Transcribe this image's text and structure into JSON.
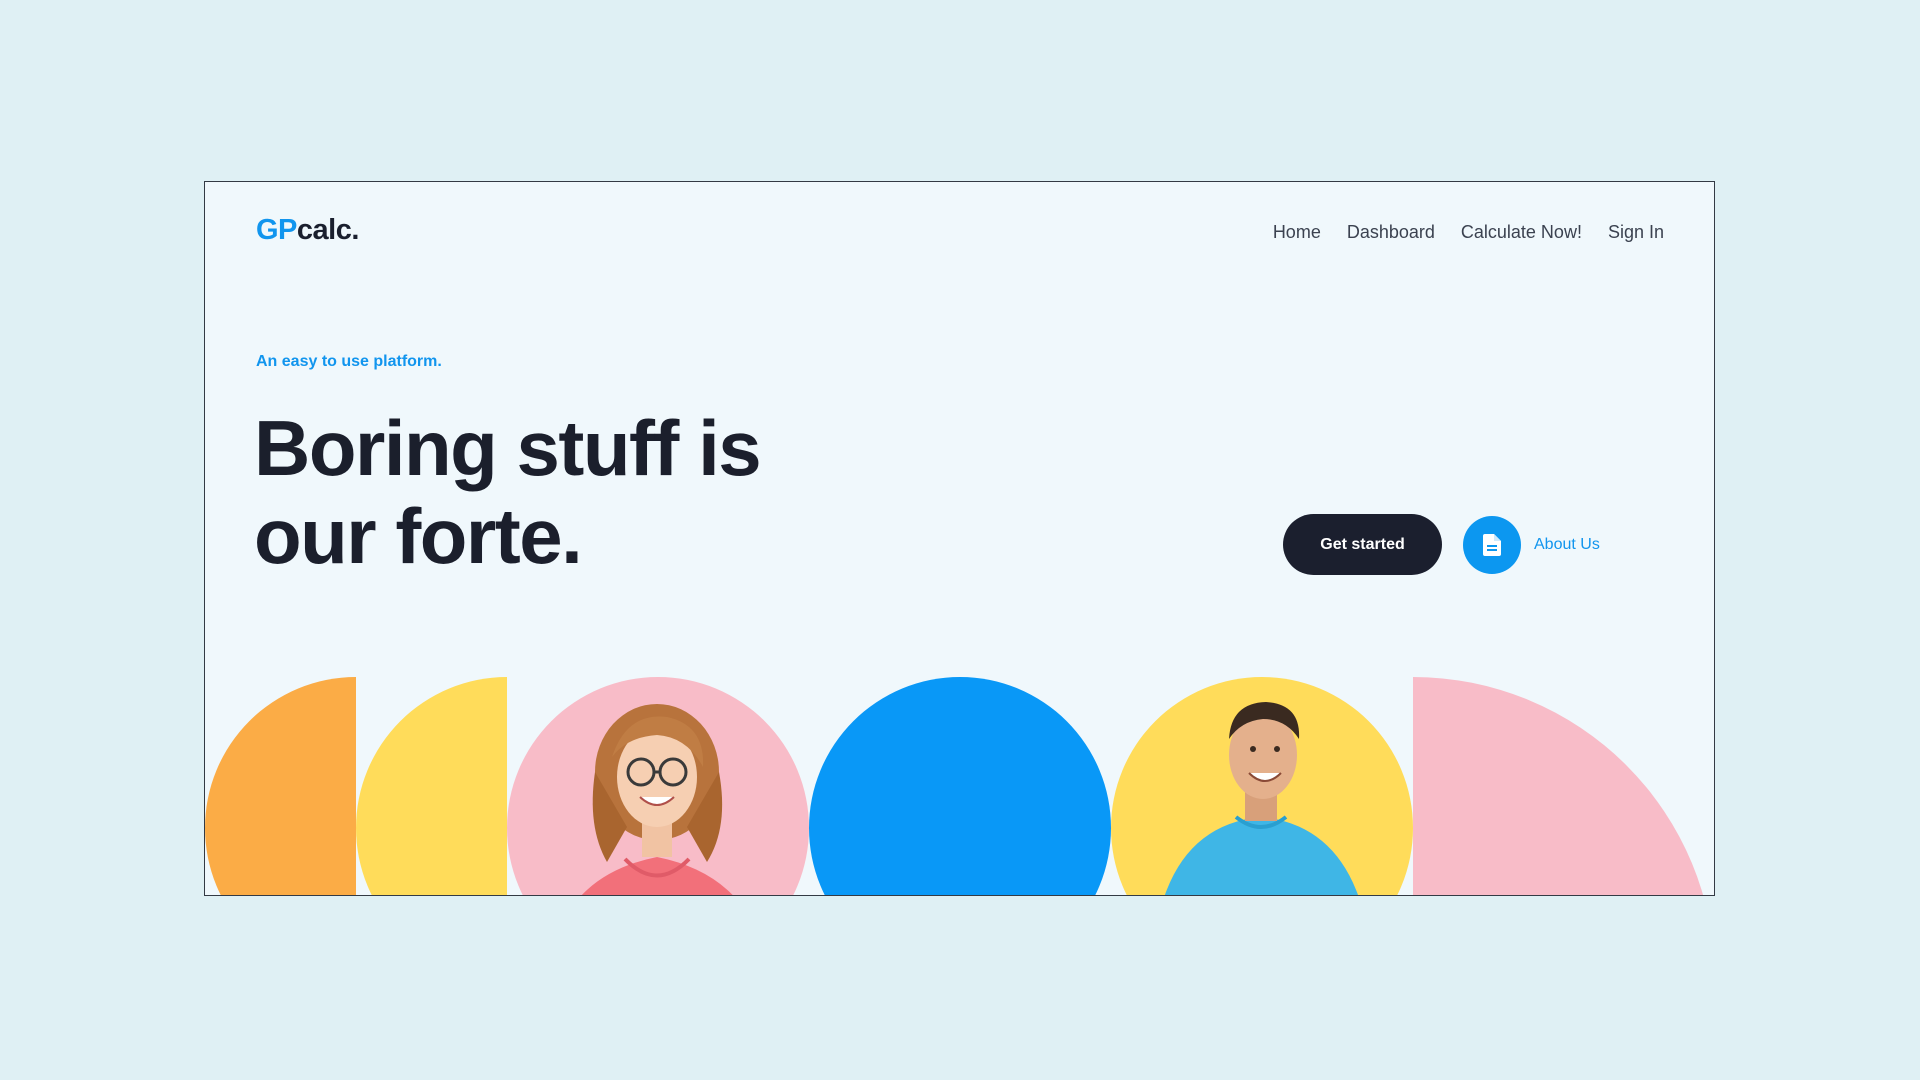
{
  "brand": {
    "logo_prefix": "GP",
    "logo_suffix": "calc.",
    "accent_color": "#1195ee",
    "dark_color": "#1b1f2e"
  },
  "nav": {
    "items": [
      {
        "label": "Home"
      },
      {
        "label": "Dashboard"
      },
      {
        "label": "Calculate Now!"
      },
      {
        "label": "Sign In"
      }
    ]
  },
  "hero": {
    "eyebrow": "An easy to use platform.",
    "headline_line1": "Boring stuff is",
    "headline_line2": "our forte."
  },
  "cta": {
    "primary_label": "Get started",
    "secondary_label": "About Us",
    "secondary_icon": "document-icon"
  },
  "decor": {
    "colors": {
      "orange": "#fbac46",
      "yellow": "#ffdc5a",
      "pink": "#f8bcc8",
      "blue": "#0998f7"
    },
    "images": [
      "woman-portrait",
      "man-portrait"
    ]
  }
}
